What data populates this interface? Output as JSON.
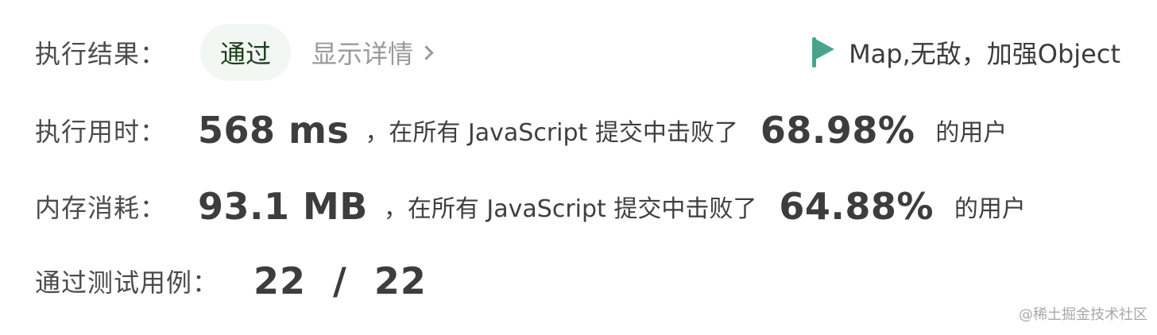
{
  "result": {
    "label": "执行结果：",
    "status": "通过",
    "details_link": "显示详情",
    "note": "Map,无敌，加强Object"
  },
  "runtime": {
    "label": "执行用时：",
    "value": "568 ms",
    "middle_text": "，在所有 JavaScript 提交中击败了",
    "percent": "68.98%",
    "suffix": "的用户"
  },
  "memory": {
    "label": "内存消耗：",
    "value": "93.1 MB",
    "middle_text": "，在所有 JavaScript 提交中击败了",
    "percent": "64.88%",
    "suffix": "的用户"
  },
  "tests": {
    "label": "通过测试用例：",
    "value": "22  /  22"
  },
  "watermark": "@稀土掘金技术社区",
  "icons": {
    "note_flag": "flag-icon",
    "details_chevron": "chevron-right-icon"
  },
  "colors": {
    "flag": "#4aa38c",
    "pill_bg": "#f3f7f3"
  }
}
